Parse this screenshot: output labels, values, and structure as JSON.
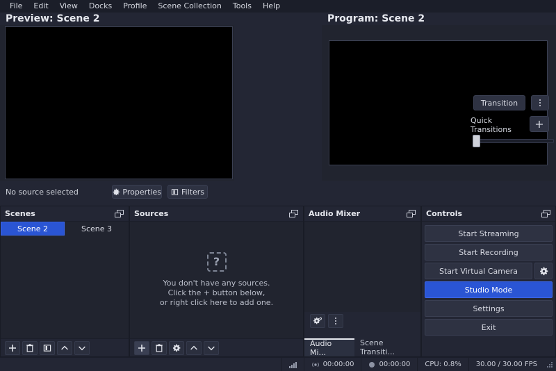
{
  "app": {
    "accent_color": "#2a55d4",
    "background_color": "#232634",
    "panel_color": "#21242f"
  },
  "menubar": {
    "items": [
      {
        "label": "File"
      },
      {
        "label": "Edit"
      },
      {
        "label": "View"
      },
      {
        "label": "Docks"
      },
      {
        "label": "Profile"
      },
      {
        "label": "Scene Collection"
      },
      {
        "label": "Tools"
      },
      {
        "label": "Help"
      }
    ]
  },
  "preview": {
    "title": "Preview: Scene 2"
  },
  "program": {
    "title": "Program: Scene 2"
  },
  "transitions": {
    "transition_label": "Transition",
    "menu_icon": "vertical-dots-icon",
    "quick_transitions_label": "Quick Transitions",
    "add_label": "+",
    "tbar_value": 0
  },
  "source_strip": {
    "status_label": "No source selected",
    "properties_label": "Properties",
    "properties_icon": "gear-icon",
    "filters_label": "Filters",
    "filters_icon": "filters-icon"
  },
  "scenes": {
    "title": "Scenes",
    "float_icon": "undock-icon",
    "items": [
      {
        "label": "Scene 2",
        "selected": true
      },
      {
        "label": "Scene 3",
        "selected": false
      }
    ],
    "toolbar": [
      {
        "icon": "add-icon",
        "name": "add-scene-button"
      },
      {
        "icon": "trash-icon",
        "name": "remove-scene-button"
      },
      {
        "icon": "filters-icon",
        "name": "scene-filters-button"
      },
      {
        "icon": "chevron-up-icon",
        "name": "move-scene-up-button"
      },
      {
        "icon": "chevron-down-icon",
        "name": "move-scene-down-button"
      }
    ]
  },
  "sources": {
    "title": "Sources",
    "float_icon": "undock-icon",
    "empty_icon": "question-mark-icon",
    "empty_lines": [
      "You don't have any sources.",
      "Click the + button below,",
      "or right click here to add one."
    ],
    "toolbar": [
      {
        "icon": "add-icon",
        "name": "add-source-button"
      },
      {
        "icon": "trash-icon",
        "name": "remove-source-button"
      },
      {
        "icon": "gear-icon",
        "name": "source-properties-button"
      },
      {
        "icon": "chevron-up-icon",
        "name": "move-source-up-button"
      },
      {
        "icon": "chevron-down-icon",
        "name": "move-source-down-button"
      }
    ]
  },
  "audio_mixer": {
    "title": "Audio Mixer",
    "float_icon": "undock-icon",
    "advanced_icon": "audio-settings-icon",
    "menu_icon": "vertical-dots-icon",
    "tabs": [
      {
        "label": "Audio Mi...",
        "active": true
      },
      {
        "label": "Scene Transiti...",
        "active": false
      }
    ]
  },
  "controls": {
    "title": "Controls",
    "float_icon": "undock-icon",
    "buttons": [
      {
        "label": "Start Streaming",
        "active": false
      },
      {
        "label": "Start Recording",
        "active": false
      },
      {
        "label": "Start Virtual Camera",
        "active": false,
        "gear": true
      },
      {
        "label": "Studio Mode",
        "active": true
      },
      {
        "label": "Settings",
        "active": false
      },
      {
        "label": "Exit",
        "active": false
      }
    ],
    "virtual_camera_settings_icon": "gear-icon"
  },
  "statusbar": {
    "signal_icon": "signal-bars-icon",
    "stream_icon": "broadcast-icon",
    "stream_time": "00:00:00",
    "record_icon": "record-dot-icon",
    "record_time": "00:00:00",
    "cpu": "CPU: 0.8%",
    "fps": "30.00 / 30.00 FPS",
    "resize_grip_icon": "resize-grip-icon"
  }
}
